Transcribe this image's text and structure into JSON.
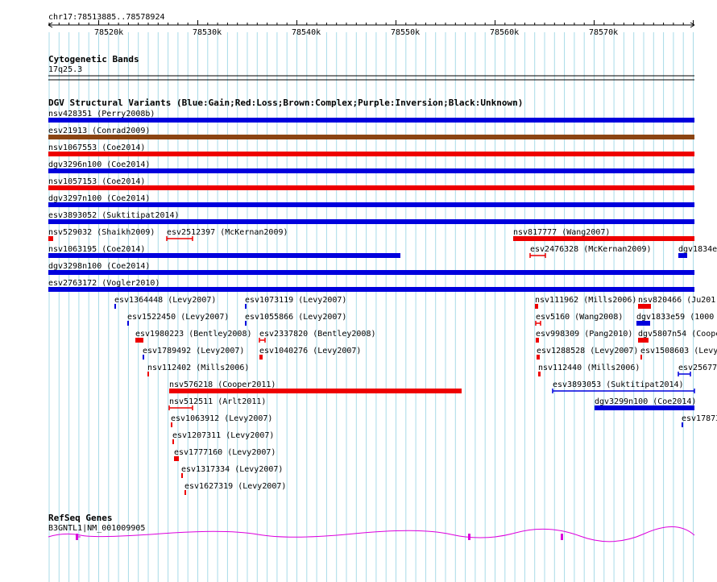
{
  "header": {
    "coordinates": "chr17:78513885..78578924",
    "ticks": [
      "78520k",
      "78530k",
      "78540k",
      "78550k",
      "78560k",
      "78570k"
    ]
  },
  "cytoband": {
    "title": "Cytogenetic Bands",
    "band": "17q25.3"
  },
  "dgv": {
    "title": "DGV Structural Variants (Blue:Gain;Red:Loss;Brown:Complex;Purple:Inversion;Black:Unknown)",
    "colors": {
      "gain": "#0000dd",
      "loss": "#ee0000",
      "complex": "#8b4513"
    },
    "features": [
      {
        "label": "nsv428351 (Perry2008b)",
        "type": "gain"
      },
      {
        "label": "esv21913 (Conrad2009)",
        "type": "complex"
      },
      {
        "label": "nsv1067553 (Coe2014)",
        "type": "loss"
      },
      {
        "label": "dgv3296n100 (Coe2014)",
        "type": "gain"
      },
      {
        "label": "nsv1057153 (Coe2014)",
        "type": "loss"
      },
      {
        "label": "dgv3297n100 (Coe2014)",
        "type": "gain"
      },
      {
        "label": "esv3893052 (Suktitipat2014)",
        "type": "gain"
      },
      {
        "label": "nsv529032 (Shaikh2009)",
        "type": "loss"
      },
      {
        "label": "esv2512397 (McKernan2009)",
        "type": "loss"
      },
      {
        "label": "nsv817777 (Wang2007)",
        "type": "loss"
      },
      {
        "label": "nsv1063195 (Coe2014)",
        "type": "gain"
      },
      {
        "label": "esv2476328 (McKernan2009)",
        "type": "loss"
      },
      {
        "label": "dgv1834e",
        "type": "gain"
      },
      {
        "label": "dgv3298n100 (Coe2014)",
        "type": "gain"
      },
      {
        "label": "esv2763172 (Vogler2010)",
        "type": "gain"
      },
      {
        "label": "esv1364448 (Levy2007)",
        "type": "gain"
      },
      {
        "label": "esv1073119 (Levy2007)",
        "type": "gain"
      },
      {
        "label": "nsv111962 (Mills2006)",
        "type": "loss"
      },
      {
        "label": "nsv820466 (Ju201",
        "type": "loss"
      },
      {
        "label": "esv1522450 (Levy2007)",
        "type": "gain"
      },
      {
        "label": "esv1055866 (Levy2007)",
        "type": "gain"
      },
      {
        "label": "esv5160 (Wang2008)",
        "type": "loss"
      },
      {
        "label": "dgv1833e59 (1000",
        "type": "gain"
      },
      {
        "label": "esv1980223 (Bentley2008)",
        "type": "loss"
      },
      {
        "label": "esv2337820 (Bentley2008)",
        "type": "loss"
      },
      {
        "label": "esv998309 (Pang2010)",
        "type": "loss"
      },
      {
        "label": "dgv5807n54 (Coope",
        "type": "loss"
      },
      {
        "label": "esv1789492 (Levy2007)",
        "type": "gain"
      },
      {
        "label": "esv1040276 (Levy2007)",
        "type": "loss"
      },
      {
        "label": "esv1288528 (Levy2007)",
        "type": "loss"
      },
      {
        "label": "esv1508603 (Levy",
        "type": "loss"
      },
      {
        "label": "nsv112402 (Mills2006)",
        "type": "loss"
      },
      {
        "label": "nsv112440 (Mills2006)",
        "type": "loss"
      },
      {
        "label": "esv25677",
        "type": "gain"
      },
      {
        "label": "nsv576218 (Cooper2011)",
        "type": "loss"
      },
      {
        "label": "esv3893053 (Suktitipat2014)",
        "type": "gain"
      },
      {
        "label": "nsv512511 (Arlt2011)",
        "type": "loss"
      },
      {
        "label": "dgv3299n100 (Coe2014)",
        "type": "gain"
      },
      {
        "label": "esv1063912 (Levy2007)",
        "type": "loss"
      },
      {
        "label": "esv17873",
        "type": "gain"
      },
      {
        "label": "esv1207311 (Levy2007)",
        "type": "loss"
      },
      {
        "label": "esv1777160 (Levy2007)",
        "type": "loss"
      },
      {
        "label": "esv1317334 (Levy2007)",
        "type": "loss"
      },
      {
        "label": "esv1627319 (Levy2007)",
        "type": "loss"
      }
    ]
  },
  "refseq": {
    "title": "RefSeq Genes",
    "gene": "B3GNTL1|NM_001009905",
    "color": "#dd00dd"
  },
  "colors": {
    "grid": "#a8dbe8",
    "axis": "#000000"
  }
}
